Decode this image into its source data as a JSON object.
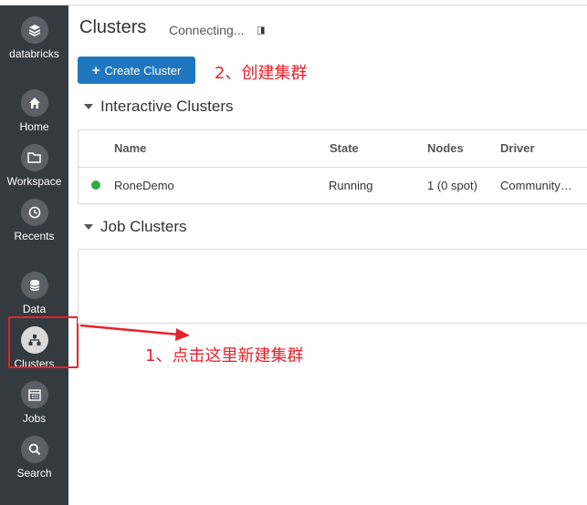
{
  "sidebar": {
    "brand": {
      "label": "databricks",
      "icon": "layers-icon"
    },
    "items": [
      {
        "label": "Home",
        "icon": "home-icon"
      },
      {
        "label": "Workspace",
        "icon": "folder-icon"
      },
      {
        "label": "Recents",
        "icon": "clock-icon"
      },
      {
        "label": "Data",
        "icon": "database-icon"
      },
      {
        "label": "Clusters",
        "icon": "cluster-icon",
        "active": true
      },
      {
        "label": "Jobs",
        "icon": "calendar-icon"
      },
      {
        "label": "Search",
        "icon": "search-icon"
      }
    ]
  },
  "header": {
    "title": "Clusters",
    "status": "Connecting..."
  },
  "toolbar": {
    "create_label": "Create Cluster"
  },
  "annotations": {
    "step1": "1、点击这里新建集群",
    "step2": "2、创建集群"
  },
  "interactive": {
    "title": "Interactive Clusters",
    "columns": [
      "Name",
      "State",
      "Nodes",
      "Driver"
    ],
    "rows": [
      {
        "name": "RoneDemo",
        "state": "Running",
        "nodes": "1 (0 spot)",
        "driver": "Community…"
      }
    ]
  },
  "jobs": {
    "title": "Job Clusters"
  },
  "colors": {
    "sidebar": "#333a40",
    "accent": "#1f77c0",
    "annotation": "#e8212b",
    "running": "#2daa47"
  }
}
